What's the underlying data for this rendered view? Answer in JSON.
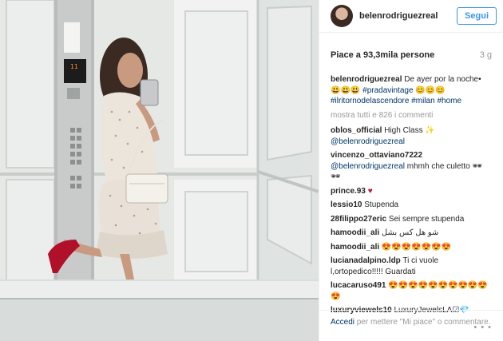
{
  "post": {
    "username": "belenrodriguezreal",
    "follow_label": "Segui",
    "likes_text": "Piace a 93,3mila persone",
    "time_ago": "3 g",
    "caption_user": "belenrodriguezreal",
    "caption_text": "De ayer por la noche• 😃😃😃 ",
    "caption_tag1": "#pradavintage",
    "caption_emoji": " 😊😊😊",
    "caption_tag2": "#ilritornodelascendore",
    "caption_tag3": "#milan",
    "caption_tag4": "#home",
    "show_all": "mostra tutti e 826 i commenti"
  },
  "comments": [
    {
      "user": "oblos_official",
      "text": "High Class ✨",
      "mention": "@belenrodriguezreal"
    },
    {
      "user": "vincenzo_ottaviano7222",
      "mention": "@belenrodriguezreal",
      "text": "mhmh che culetto 🕶🕶"
    },
    {
      "user": "prince.93",
      "text": "♥"
    },
    {
      "user": "lessio10",
      "text": "Stupenda"
    },
    {
      "user": "28filippo27eric",
      "text": "Sei sempre stupenda"
    },
    {
      "user": "hamoodii_ali",
      "text": "شو هل كس بشل"
    },
    {
      "user": "hamoodii_ali",
      "text": "😍😍😍😍😍😍😍"
    },
    {
      "user": "lucianadalpino.ldp",
      "text": "Ti ci vuole l,ortopedico!!!!! Guardati"
    },
    {
      "user": "lucacaruso491",
      "text": "😍😍😍😍😍😍😍😍😍😍😍"
    },
    {
      "user": "luxuryviewels10",
      "text": "LuxuryJewelsLA☑💎"
    }
  ],
  "footer": {
    "login": "Accedi",
    "rest": " per mettere \"Mi piace\" o commentare.",
    "more": "• • •"
  },
  "elevator": {
    "floor": "11"
  }
}
